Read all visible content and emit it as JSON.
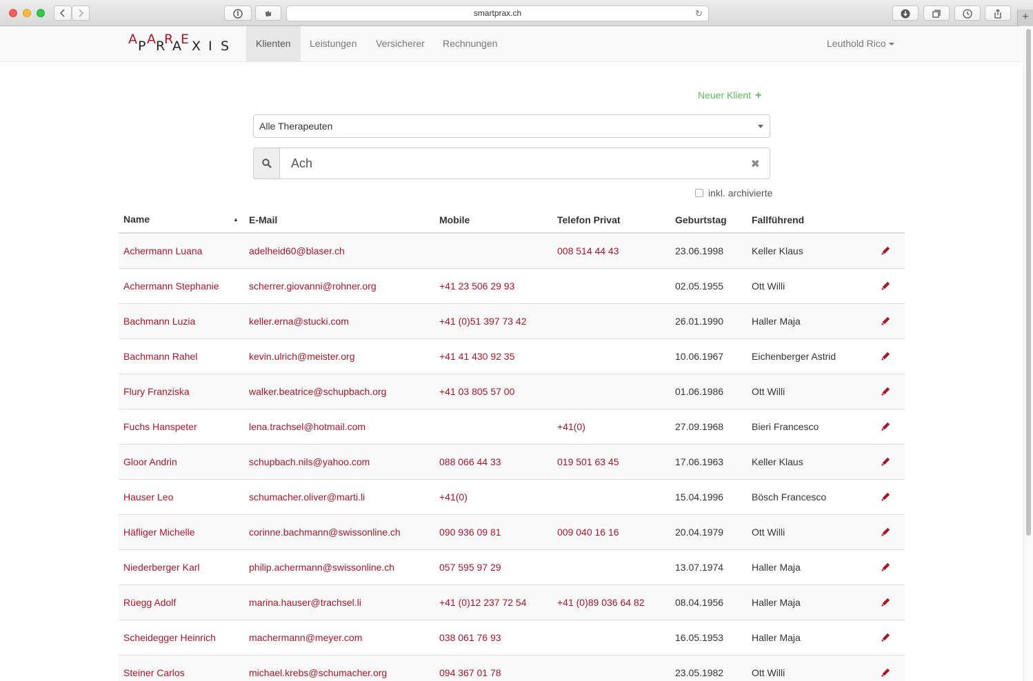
{
  "browser": {
    "url": "smartprax.ch",
    "new_tab_symbol": "+"
  },
  "nav": {
    "logo_letters": [
      "A",
      "P",
      "A",
      "R",
      "R",
      "A",
      "E",
      "X",
      "I",
      "S"
    ],
    "items": [
      {
        "label": "Klienten",
        "active": true
      },
      {
        "label": "Leistungen",
        "active": false
      },
      {
        "label": "Versicherer",
        "active": false
      },
      {
        "label": "Rechnungen",
        "active": false
      }
    ],
    "user": "Leuthold Rico"
  },
  "toolbar": {
    "new_client_label": "Neuer Klient",
    "new_client_icon": "+"
  },
  "filter": {
    "therapist_selected": "Alle Therapeuten",
    "search_value": "Ach",
    "clear_icon": "✖",
    "archived_label": "inkl. archivierte",
    "archived_checked": false
  },
  "table": {
    "sort_indicator": "▲",
    "headers": {
      "name": "Name",
      "email": "E-Mail",
      "mobile": "Mobile",
      "phone": "Telefon Privat",
      "birthday": "Geburtstag",
      "lead": "Fallführend"
    },
    "rows": [
      {
        "name": "Achermann Luana",
        "email": "adelheid60@blaser.ch",
        "mobile": "",
        "phone": "008 514 44 43",
        "birthday": "23.06.1998",
        "lead": "Keller Klaus"
      },
      {
        "name": "Achermann Stephanie",
        "email": "scherrer.giovanni@rohner.org",
        "mobile": "+41 23 506 29 93",
        "phone": "",
        "birthday": "02.05.1955",
        "lead": "Ott Willi"
      },
      {
        "name": "Bachmann Luzia",
        "email": "keller.erna@stucki.com",
        "mobile": "+41 (0)51 397 73 42",
        "phone": "",
        "birthday": "26.01.1990",
        "lead": "Haller Maja"
      },
      {
        "name": "Bachmann Rahel",
        "email": "kevin.ulrich@meister.org",
        "mobile": "+41 41 430 92 35",
        "phone": "",
        "birthday": "10.06.1967",
        "lead": "Eichenberger Astrid"
      },
      {
        "name": "Flury Franziska",
        "email": "walker.beatrice@schupbach.org",
        "mobile": "+41 03 805 57 00",
        "phone": "",
        "birthday": "01.06.1986",
        "lead": "Ott Willi"
      },
      {
        "name": "Fuchs Hanspeter",
        "email": "lena.trachsel@hotmail.com",
        "mobile": "",
        "phone": "+41(0)",
        "birthday": "27.09.1968",
        "lead": "Bieri Francesco"
      },
      {
        "name": "Gloor Andrin",
        "email": "schupbach.nils@yahoo.com",
        "mobile": "088 066 44 33",
        "phone": "019 501 63 45",
        "birthday": "17.06.1963",
        "lead": "Keller Klaus"
      },
      {
        "name": "Hauser Leo",
        "email": "schumacher.oliver@marti.li",
        "mobile": "+41(0)",
        "phone": "",
        "birthday": "15.04.1996",
        "lead": "Bösch Francesco"
      },
      {
        "name": "Häfliger Michelle",
        "email": "corinne.bachmann@swissonline.ch",
        "mobile": "090 936 09 81",
        "phone": "009 040 16 16",
        "birthday": "20.04.1979",
        "lead": "Ott Willi"
      },
      {
        "name": "Niederberger Karl",
        "email": "philip.achermann@swissonline.ch",
        "mobile": "057 595 97 29",
        "phone": "",
        "birthday": "13.07.1974",
        "lead": "Haller Maja"
      },
      {
        "name": "Rüegg Adolf",
        "email": "marina.hauser@trachsel.li",
        "mobile": "+41 (0)12 237 72 54",
        "phone": "+41 (0)89 036 64 82",
        "birthday": "08.04.1956",
        "lead": "Haller Maja"
      },
      {
        "name": "Scheidegger Heinrich",
        "email": "machermann@meyer.com",
        "mobile": "038 061 76 93",
        "phone": "",
        "birthday": "16.05.1953",
        "lead": "Haller Maja"
      },
      {
        "name": "Steiner Carlos",
        "email": "michael.krebs@schumacher.org",
        "mobile": "094 367 01 78",
        "phone": "",
        "birthday": "23.05.1982",
        "lead": "Ott Willi"
      }
    ]
  },
  "colors": {
    "link": "#a5182a",
    "success": "#5cb85c",
    "logo": "#a5182a"
  }
}
